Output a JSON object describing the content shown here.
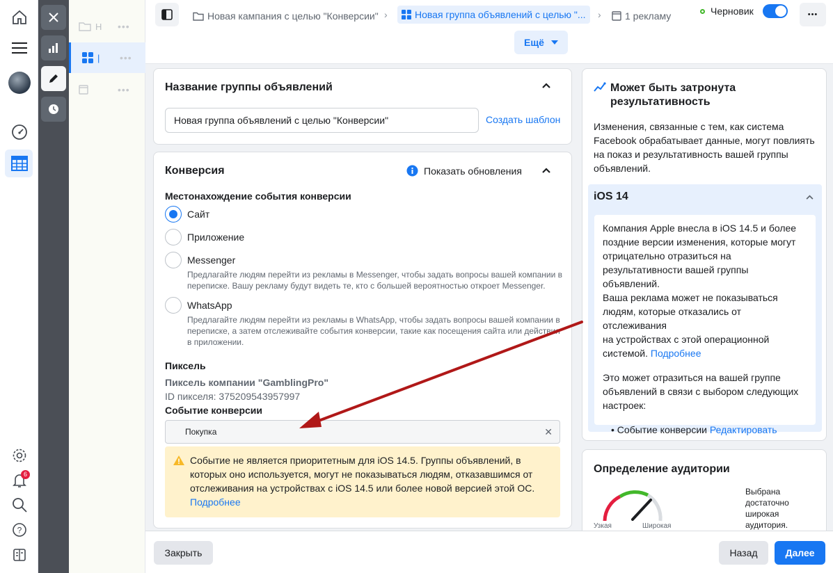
{
  "breadcrumbs": {
    "campaign": "Новая кампания с целью \"Конверсии\"",
    "adset": "Новая группа объявлений с целью \"...",
    "ad": "1 рекламу"
  },
  "status": {
    "label": "Черновик",
    "enabled": true
  },
  "more_button": "Ещё",
  "rail": {
    "notifications_count": "6"
  },
  "adset_name_card": {
    "title": "Название группы объявлений",
    "value": "Новая группа объявлений с целью \"Конверсии\"",
    "template_link": "Создать шаблон"
  },
  "conversion_card": {
    "title": "Конверсия",
    "show_updates": "Показать обновления",
    "location_heading": "Местонахождение события конверсии",
    "options": [
      {
        "label": "Сайт",
        "selected": true,
        "desc": ""
      },
      {
        "label": "Приложение",
        "selected": false,
        "desc": ""
      },
      {
        "label": "Messenger",
        "selected": false,
        "desc_1": "Предлагайте людям перейти из рекламы в Messenger, чтобы задать вопросы вашей компании в",
        "desc_2": "переписке. Вашу рекламу будут видеть те, кто с большей вероятностью откроет Messenger."
      },
      {
        "label": "WhatsApp",
        "selected": false,
        "desc_1": "Предлагайте людям перейти из рекламы в WhatsApp, чтобы задать вопросы вашей компании в",
        "desc_2": "переписке, а затем отслеживайте события конверсии, такие как посещения сайта или действия",
        "desc_3": "в приложении."
      }
    ],
    "pixel_heading": "Пиксель",
    "pixel_name": "Пиксель компании \"GamblingPro\"",
    "pixel_id": "ID пикселя: 375209543957997",
    "event_heading": "Событие конверсии",
    "event_value": "Покупка",
    "warning_1": "Событие не является приоритетным для iOS 14.5. Группы объявлений, в",
    "warning_2": "которых оно используется, могут не показываться людям, отказавшимся от",
    "warning_3": "отслеживания на устройствах с iOS 14.5 или более новой версией этой ОС.",
    "warning_link": "Подробнее"
  },
  "impact_panel": {
    "title_1": "Может быть затронута",
    "title_2": "результативность",
    "body_1": "Изменения, связанные с тем, как система",
    "body_2": "Facebook обрабатывает данные, могут повлиять",
    "body_3": "на показ и результативность вашей группы",
    "body_4": "объявлений.",
    "ios_title": "iOS 14",
    "ios_1": "Компания Apple внесла в iOS 14.5 и более",
    "ios_2": "поздние версии изменения, которые могут",
    "ios_3": "отрицательно отразиться на",
    "ios_4": "результативности вашей группы объявлений.",
    "ios_5": "Ваша реклама может не показываться",
    "ios_6": "людям, которые отказались от отслеживания",
    "ios_7": "на устройствах с этой операционной",
    "ios_8": "системой.",
    "ios_link": "Подробнее",
    "affect_1": "Это может отразиться на вашей группе",
    "affect_2": "объявлений в связи с выбором следующих",
    "affect_3": "настроек:",
    "bullet_label": "Событие конверсии",
    "bullet_link": "Редактировать"
  },
  "audience_panel": {
    "title": "Определение аудитории",
    "narrow": "Узкая",
    "wide": "Широкая",
    "desc_1": "Выбрана",
    "desc_2": "достаточно",
    "desc_3": "широкая",
    "desc_4": "аудитория."
  },
  "footer": {
    "close": "Закрыть",
    "back": "Назад",
    "next": "Далее"
  },
  "annotation_color": "#b01818"
}
